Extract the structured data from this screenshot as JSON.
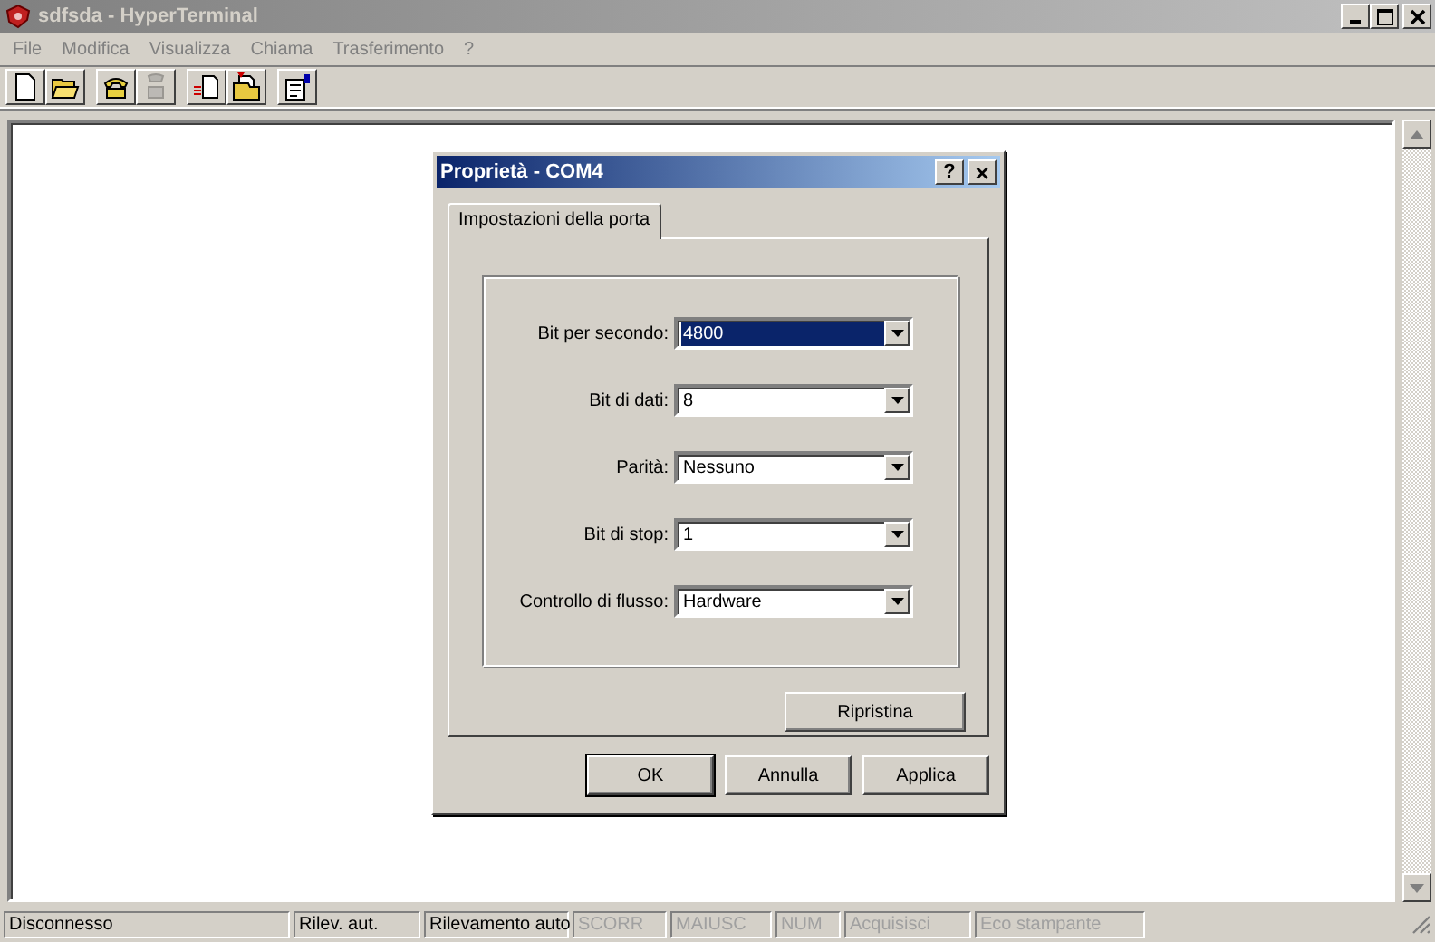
{
  "window": {
    "title": "sdfsda - HyperTerminal",
    "active": false
  },
  "menu": [
    "File",
    "Modifica",
    "Visualizza",
    "Chiama",
    "Trasferimento",
    "?"
  ],
  "toolbar": [
    {
      "kind": "new",
      "disabled": false
    },
    {
      "kind": "open",
      "disabled": false
    },
    {
      "kind": "call",
      "disabled": false
    },
    {
      "kind": "hangup",
      "disabled": true
    },
    {
      "kind": "send",
      "disabled": false
    },
    {
      "kind": "receive",
      "disabled": false
    },
    {
      "kind": "properties",
      "disabled": false
    }
  ],
  "dialog": {
    "title": "Proprietà - COM4",
    "help": "?",
    "close": "×",
    "tabs": [
      {
        "label": "Impostazioni della porta",
        "selected": true
      }
    ],
    "fields": [
      {
        "label": "Bit per secondo:",
        "value": "4800",
        "selected": true
      },
      {
        "label": "Bit di dati:",
        "value": "8",
        "selected": false
      },
      {
        "label": "Parità:",
        "value": "Nessuno",
        "selected": false
      },
      {
        "label": "Bit di stop:",
        "value": "1",
        "selected": false
      },
      {
        "label": "Controllo di flusso:",
        "value": "Hardware",
        "selected": false
      }
    ],
    "restore_button": "Ripristina",
    "buttons": [
      {
        "label": "OK",
        "default": true
      },
      {
        "label": "Annulla",
        "default": false
      },
      {
        "label": "Applica",
        "default": false
      }
    ]
  },
  "status_bar": [
    {
      "text": "Disconnesso",
      "disabled": false
    },
    {
      "text": "Rilev. aut.",
      "disabled": false
    },
    {
      "text": "Rilevamento auto",
      "disabled": false
    },
    {
      "text": "SCORR",
      "disabled": true
    },
    {
      "text": "MAIUSC",
      "disabled": true
    },
    {
      "text": "NUM",
      "disabled": true
    },
    {
      "text": "Acquisisci",
      "disabled": true
    },
    {
      "text": "Eco stampante",
      "disabled": true
    }
  ]
}
